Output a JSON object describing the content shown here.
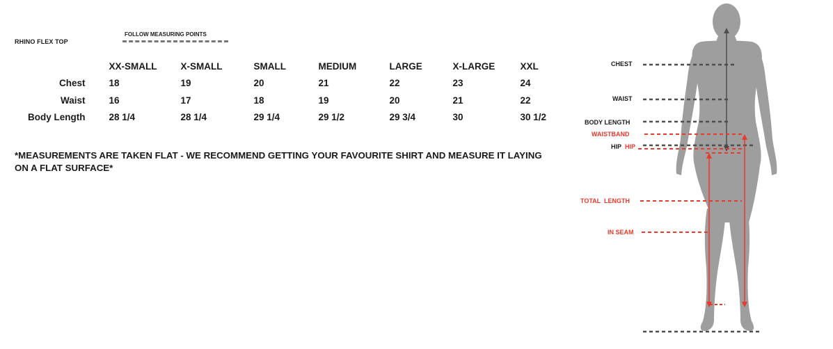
{
  "product_name": "RHINO FLEX TOP",
  "legend_text": "FOLLOW MEASURING POINTS",
  "size_table": {
    "columns": [
      "XX-SMALL",
      "X-SMALL",
      "SMALL",
      "MEDIUM",
      "LARGE",
      "X-LARGE",
      "XXL"
    ],
    "rows": [
      {
        "label": "Chest",
        "values": [
          "18",
          "19",
          "20",
          "21",
          "22",
          "23",
          "24"
        ]
      },
      {
        "label": "Waist",
        "values": [
          "16",
          "17",
          "18",
          "19",
          "20",
          "21",
          "22"
        ]
      },
      {
        "label": "Body Length",
        "values": [
          "28 1/4",
          "28 1/4",
          "29 1/4",
          "29 1/2",
          "29 3/4",
          "30",
          "30 1/2"
        ]
      }
    ]
  },
  "note": "*MEASUREMENTS ARE TAKEN FLAT - WE RECOMMEND GETTING YOUR FAVOURITE SHIRT AND MEASURE IT LAYING ON A FLAT SURFACE*",
  "figure": {
    "labels": {
      "chest": "CHEST",
      "waist": "WAIST",
      "body_length": "BODY LENGTH",
      "waistband": "WAISTBAND",
      "hip_dark": "HIP",
      "hip_red": "HIP",
      "total_length": "TOTAL  LENGTH",
      "in_seam": "IN SEAM"
    },
    "colors": {
      "dark": "#4d4d4d",
      "red": "#e8392c",
      "body": "#9e9e9e"
    }
  }
}
